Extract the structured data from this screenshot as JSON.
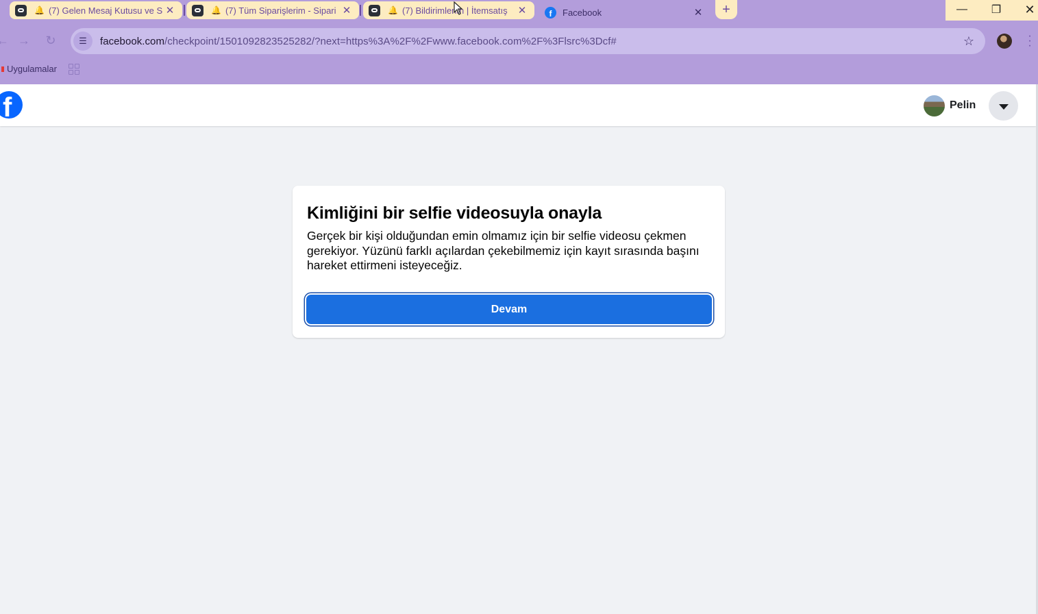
{
  "browser": {
    "tabs": [
      {
        "title": "(7) Gelen Mesaj Kutusu ve S",
        "active": false
      },
      {
        "title": "(7) Tüm Siparişlerim - Sipari",
        "active": false
      },
      {
        "title": "(7) Bildirimlerim | İtemsatış",
        "active": false
      },
      {
        "title": "Facebook",
        "active": true
      }
    ],
    "close_glyph": "✕",
    "new_tab_glyph": "+",
    "window_controls": {
      "minimize": "—",
      "restore": "❐",
      "close": "✕"
    },
    "url": {
      "host": "facebook.com",
      "path": "/checkpoint/1501092823525282/?next=https%3A%2F%2Fwww.facebook.com%2F%3Flsrc%3Dcf#"
    },
    "bookmarks": {
      "apps_label": "Uygulamalar"
    },
    "icons": [
      "back-arrow-icon",
      "forward-arrow-icon",
      "reload-icon",
      "site-info-icon",
      "star-icon",
      "apps-grid-icon",
      "bell-icon"
    ]
  },
  "fb": {
    "logo_letter": "f",
    "user": {
      "name": "Pelin"
    },
    "card": {
      "title": "Kimliğini bir selfie videosuyla onayla",
      "body": "Gerçek bir kişi olduğundan emin olmamız için bir selfie videosu çekmen gerekiyor. Yüzünü farklı açılardan çekebilmemiz için kayıt sırasında başını hareket ettirmeni isteyeceğiz.",
      "continue_label": "Devam"
    },
    "colors": {
      "brand": "#0866ff",
      "button": "#1b6fe0",
      "page_bg": "#f0f2f5",
      "chrome": "#b39ddb"
    }
  }
}
